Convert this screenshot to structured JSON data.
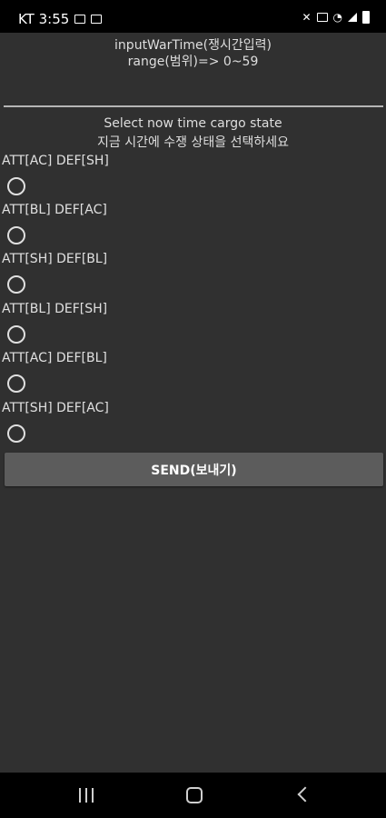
{
  "status_bar": {
    "carrier_time": "KT 3:55",
    "right_icons": [
      "mute-icon",
      "nfc-icon",
      "wifi-icon",
      "signal-icon",
      "battery-icon"
    ]
  },
  "form": {
    "war_time_label": "inputWarTime(쟁시간입력)",
    "range_label": "range(범위)=> 0~59",
    "war_time_value": "",
    "select_label_en": "Select now time cargo state",
    "select_label_ko": "지금 시간에 수쟁 상태을 선택하세요",
    "options": [
      {
        "label": "ATT[AC] DEF[SH]"
      },
      {
        "label": "ATT[BL] DEF[AC]"
      },
      {
        "label": "ATT[SH] DEF[BL]"
      },
      {
        "label": "ATT[BL] DEF[SH]"
      },
      {
        "label": "ATT[AC] DEF[BL]"
      },
      {
        "label": "ATT[SH] DEF[AC]"
      }
    ],
    "send_label": "SEND(보내기)"
  },
  "colors": {
    "background": "#303030",
    "button": "#5c5c5c",
    "bars": "#000000"
  },
  "nav_bar": {
    "icons": [
      "recents-icon",
      "home-icon",
      "back-icon"
    ]
  }
}
